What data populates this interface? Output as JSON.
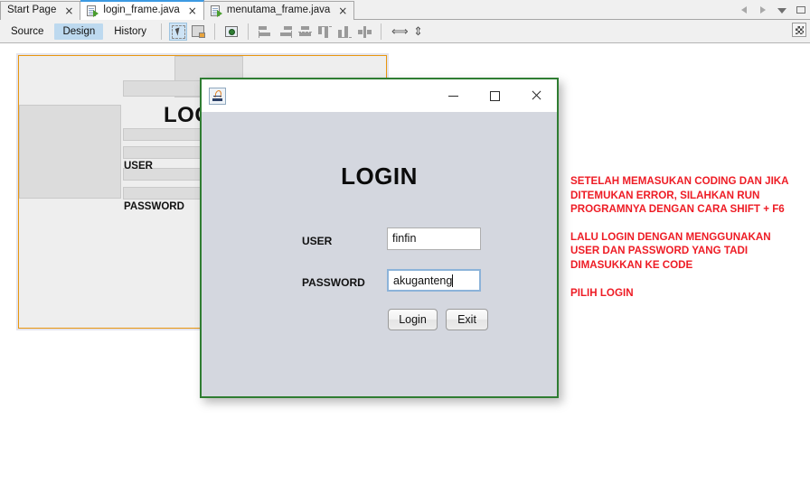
{
  "tabs": [
    {
      "label": "Start Page",
      "icon": "none",
      "active": false,
      "close": "×"
    },
    {
      "label": "login_frame.java",
      "icon": "java-file-icon",
      "active": true,
      "close": "×"
    },
    {
      "label": "menutama_frame.java",
      "icon": "java-file-icon",
      "active": false,
      "close": "×"
    }
  ],
  "window_controls": [
    {
      "name": "scroll-tabs-left",
      "glyph": "◀"
    },
    {
      "name": "scroll-tabs-right",
      "glyph": "▶"
    },
    {
      "name": "tab-list-dropdown",
      "glyph": "▼"
    },
    {
      "name": "maximize-window",
      "glyph": "□"
    }
  ],
  "toolbar": {
    "view_tabs": [
      {
        "label": "Source",
        "selected": false
      },
      {
        "label": "Design",
        "selected": true
      },
      {
        "label": "History",
        "selected": false
      }
    ],
    "buttons": [
      {
        "name": "selection-mode-icon",
        "selected": true
      },
      {
        "name": "connection-mode-icon",
        "selected": false
      },
      {
        "name": "preview-design-icon",
        "selected": false
      },
      {
        "name": "align-left-icon",
        "selected": false
      },
      {
        "name": "align-right-icon",
        "selected": false
      },
      {
        "name": "align-center-horizontal-icon",
        "selected": false
      },
      {
        "name": "align-top-icon",
        "selected": false
      },
      {
        "name": "align-bottom-icon",
        "selected": false
      },
      {
        "name": "center-vertical-icon",
        "selected": false
      },
      {
        "name": "resize-horizontal-icon",
        "selected": false,
        "glyph": "⟺"
      },
      {
        "name": "resize-vertical-icon",
        "selected": false,
        "glyph": "⇕"
      }
    ],
    "expand_label": "⌗"
  },
  "designer": {
    "title": "LOGIN",
    "labels": [
      {
        "text": "USER"
      },
      {
        "text": "PASSWORD"
      }
    ]
  },
  "dialog": {
    "title_icon": "java-app-icon",
    "title": "",
    "minimize": "—",
    "maximize": "□",
    "close": "✕",
    "heading": "LOGIN",
    "fields": [
      {
        "label": "USER",
        "value": "finfin",
        "placeholder": "",
        "focused": false
      },
      {
        "label": "PASSWORD",
        "value": "akuganteng",
        "placeholder": "",
        "focused": true
      }
    ],
    "buttons": [
      {
        "label": "Login"
      },
      {
        "label": "Exit"
      }
    ]
  },
  "notes": {
    "color": "#ee1c25",
    "paragraphs": [
      "SETELAH MEMASUKAN CODING DAN JIKA DITEMUKAN ERROR, SILAHKAN RUN PROGRAMNYA DENGAN CARA SHIFT + F6",
      "LALU LOGIN DENGAN MENGGUNAKAN USER DAN PASSWORD YANG TADI DIMASUKKAN KE CODE",
      "PILIH LOGIN"
    ]
  }
}
